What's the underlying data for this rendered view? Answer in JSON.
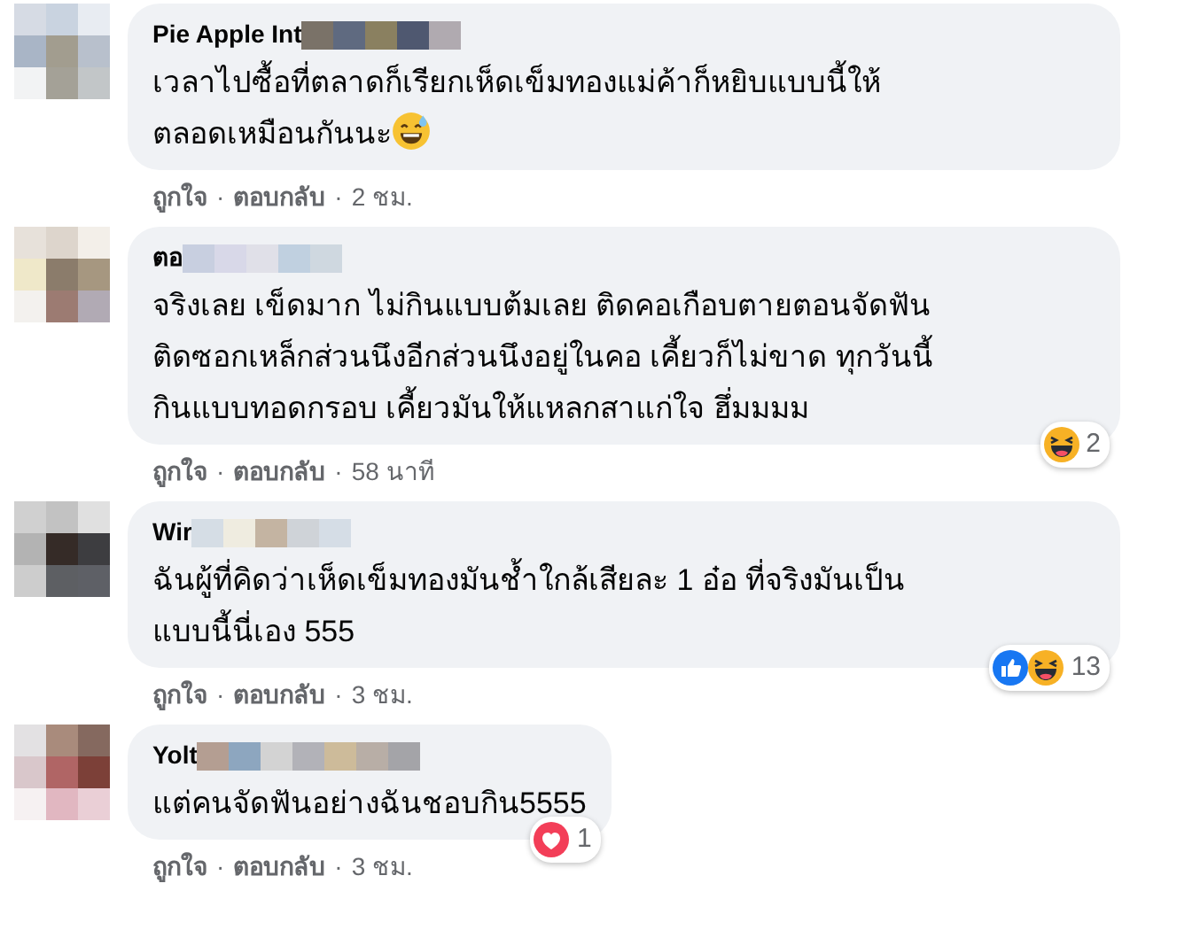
{
  "comments": [
    {
      "author": "Pie Apple Int",
      "name_redacted": true,
      "text": "เวลาไปซื้อที่ตลาดก็เรียกเห็ดเข็มทองแม่ค้าก็หยิบแบบนี้ให้\nตลอดเหมือนกันนะ",
      "emoji": {
        "kind": "sweat-smile"
      },
      "meta": [
        {
          "kind": "action",
          "text": "ถูกใจ"
        },
        {
          "kind": "separator",
          "text": "·"
        },
        {
          "kind": "action",
          "text": "ตอบกลับ"
        },
        {
          "kind": "separator",
          "text": "·"
        },
        {
          "kind": "time",
          "text": "2 ชม."
        }
      ]
    },
    {
      "author": "ตอ",
      "name_redacted": true,
      "text": "จริงเลย เข็ดมาก ไม่กินแบบต้มเลย ติดคอเกือบตายตอนจัดฟัน\nติดซอกเหล็กส่วนนึงอีกส่วนนึงอยู่ในคอ เคี้ยวก็ไม่ขาด ทุกวันนี้\nกินแบบทอดกรอบ เคี้ยวมันให้แหลกสาแก่ใจ ฮึ่มมมม",
      "reactions": [
        {
          "kind": "haha"
        }
      ],
      "reaction_count": "2",
      "meta": [
        {
          "kind": "action",
          "text": "ถูกใจ"
        },
        {
          "kind": "separator",
          "text": "·"
        },
        {
          "kind": "action",
          "text": "ตอบกลับ"
        },
        {
          "kind": "separator",
          "text": "·"
        },
        {
          "kind": "time",
          "text": "58 นาที"
        }
      ]
    },
    {
      "author": "Wir",
      "name_redacted": true,
      "text": "ฉันผู้ที่คิดว่าเห็ดเข็มทองมันช้ำใกล้เสียละ 1 อ๋อ ที่จริงมันเป็น\nแบบนี้นี่เอง 555",
      "reactions": [
        {
          "kind": "like"
        },
        {
          "kind": "haha"
        }
      ],
      "reaction_count": "13",
      "meta": [
        {
          "kind": "action",
          "text": "ถูกใจ"
        },
        {
          "kind": "separator",
          "text": "·"
        },
        {
          "kind": "action",
          "text": "ตอบกลับ"
        },
        {
          "kind": "separator",
          "text": "·"
        },
        {
          "kind": "time",
          "text": "3 ชม."
        }
      ]
    },
    {
      "author": "Yolt",
      "name_redacted": true,
      "text": "แต่คนจัดฟันอย่างฉันชอบกิน5555",
      "reactions": [
        {
          "kind": "love"
        }
      ],
      "reaction_count": "1",
      "meta": [
        {
          "kind": "action",
          "text": "ถูกใจ"
        },
        {
          "kind": "separator",
          "text": "·"
        },
        {
          "kind": "action",
          "text": "ตอบกลับ"
        },
        {
          "kind": "separator",
          "text": "·"
        },
        {
          "kind": "time",
          "text": "3 ชม."
        }
      ]
    }
  ]
}
